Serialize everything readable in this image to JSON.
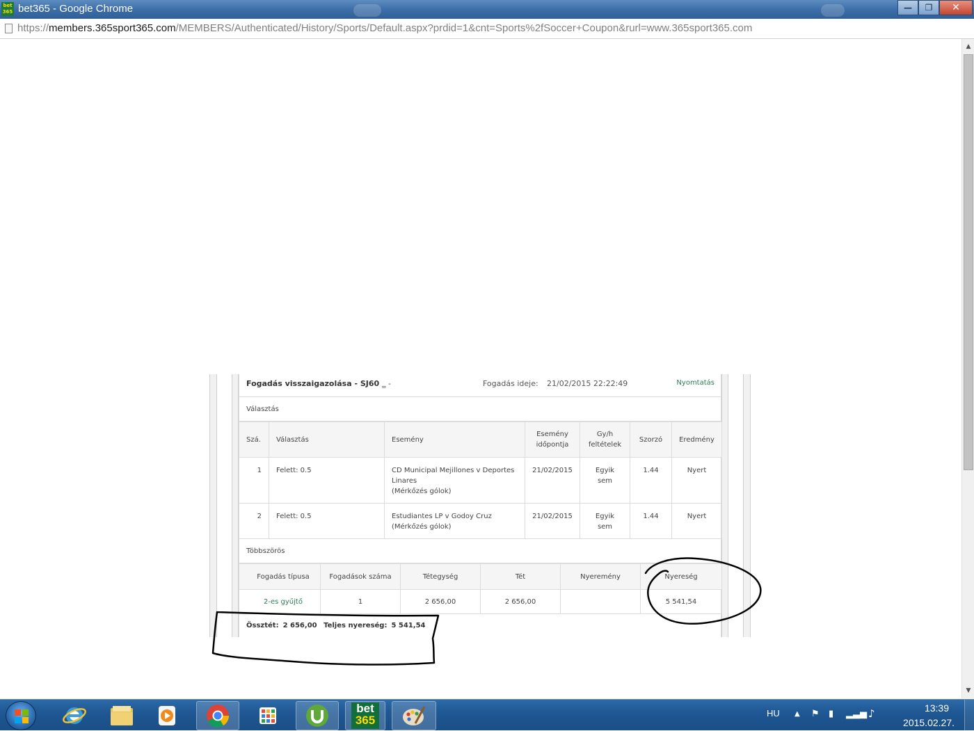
{
  "window": {
    "title": "bet365 - Google Chrome",
    "favicon_text": "bet 365",
    "buttons": {
      "minimize": "—",
      "maximize": "❐",
      "close": "✕"
    }
  },
  "address_bar": {
    "scheme": "https://",
    "host": "members.365sport365.com",
    "path": "/MEMBERS/Authenticated/History/Sports/Default.aspx?prdid=1&cnt=Sports%2fSoccer+Coupon&rurl=www.365sport365.com"
  },
  "bet": {
    "title": "Fogadás visszaigazolása  - SJ60",
    "title_redacted_tail": "‗     -",
    "time_label": "Fogadás ideje:",
    "time_value": "21/02/2015 22:22:49",
    "print_link": "Nyomtatás"
  },
  "selections": {
    "section_label": "Választás",
    "headers": {
      "no": "Szá.",
      "selection": "Választás",
      "event": "Esemény",
      "event_time": "Esemény időpontja",
      "ew": "Gy/h feltételek",
      "odds": "Szorzó",
      "result": "Eredmény"
    },
    "rows": [
      {
        "no": "1",
        "selection": "Felett: 0.5",
        "event": "CD Municipal Mejillones v Deportes Linares",
        "market": "(Mérkőzés gólok)",
        "event_time": "21/02/2015",
        "ew": "Egyik sem",
        "odds": "1.44",
        "result": "Nyert"
      },
      {
        "no": "2",
        "selection": "Felett: 0.5",
        "event": "Estudiantes LP v Godoy Cruz",
        "market": "(Mérkőzés gólok)",
        "event_time": "21/02/2015",
        "ew": "Egyik sem",
        "odds": "1.44",
        "result": "Nyert"
      }
    ]
  },
  "multiples": {
    "section_label": "Többszörös",
    "headers": {
      "bet_type": "Fogadás típusa",
      "num_bets": "Fogadások száma",
      "unit_stake": "Tétegység",
      "stake": "Tét",
      "winnings": "Nyeremény",
      "profit": "Nyereség"
    },
    "row": {
      "bet_type": "2-es gyűjtő",
      "num_bets": "1",
      "unit_stake": "2 656,00",
      "stake": "2 656,00",
      "winnings": "",
      "profit": "5 541,54"
    }
  },
  "totals": {
    "total_stake_label": "Össztét:",
    "total_stake": "2 656,00",
    "total_return_label": "Teljes nyereség:",
    "total_return": "5 541,54"
  },
  "taskbar": {
    "apps": [
      "windows-start",
      "internet-explorer",
      "file-explorer",
      "media-player",
      "google-chrome",
      "app-launcher",
      "utorrent",
      "bet365",
      "paint"
    ],
    "bet365_label_top": "bet",
    "bet365_label_bottom": "365",
    "tray": {
      "language": "HU",
      "time": "13:39",
      "date": "2015.02.27."
    }
  },
  "colors": {
    "link_green": "#2c7c55",
    "title_bar_blue": "#3d6ea8",
    "taskbar_blue": "#1f5894",
    "annotation_ink": "#000000"
  }
}
